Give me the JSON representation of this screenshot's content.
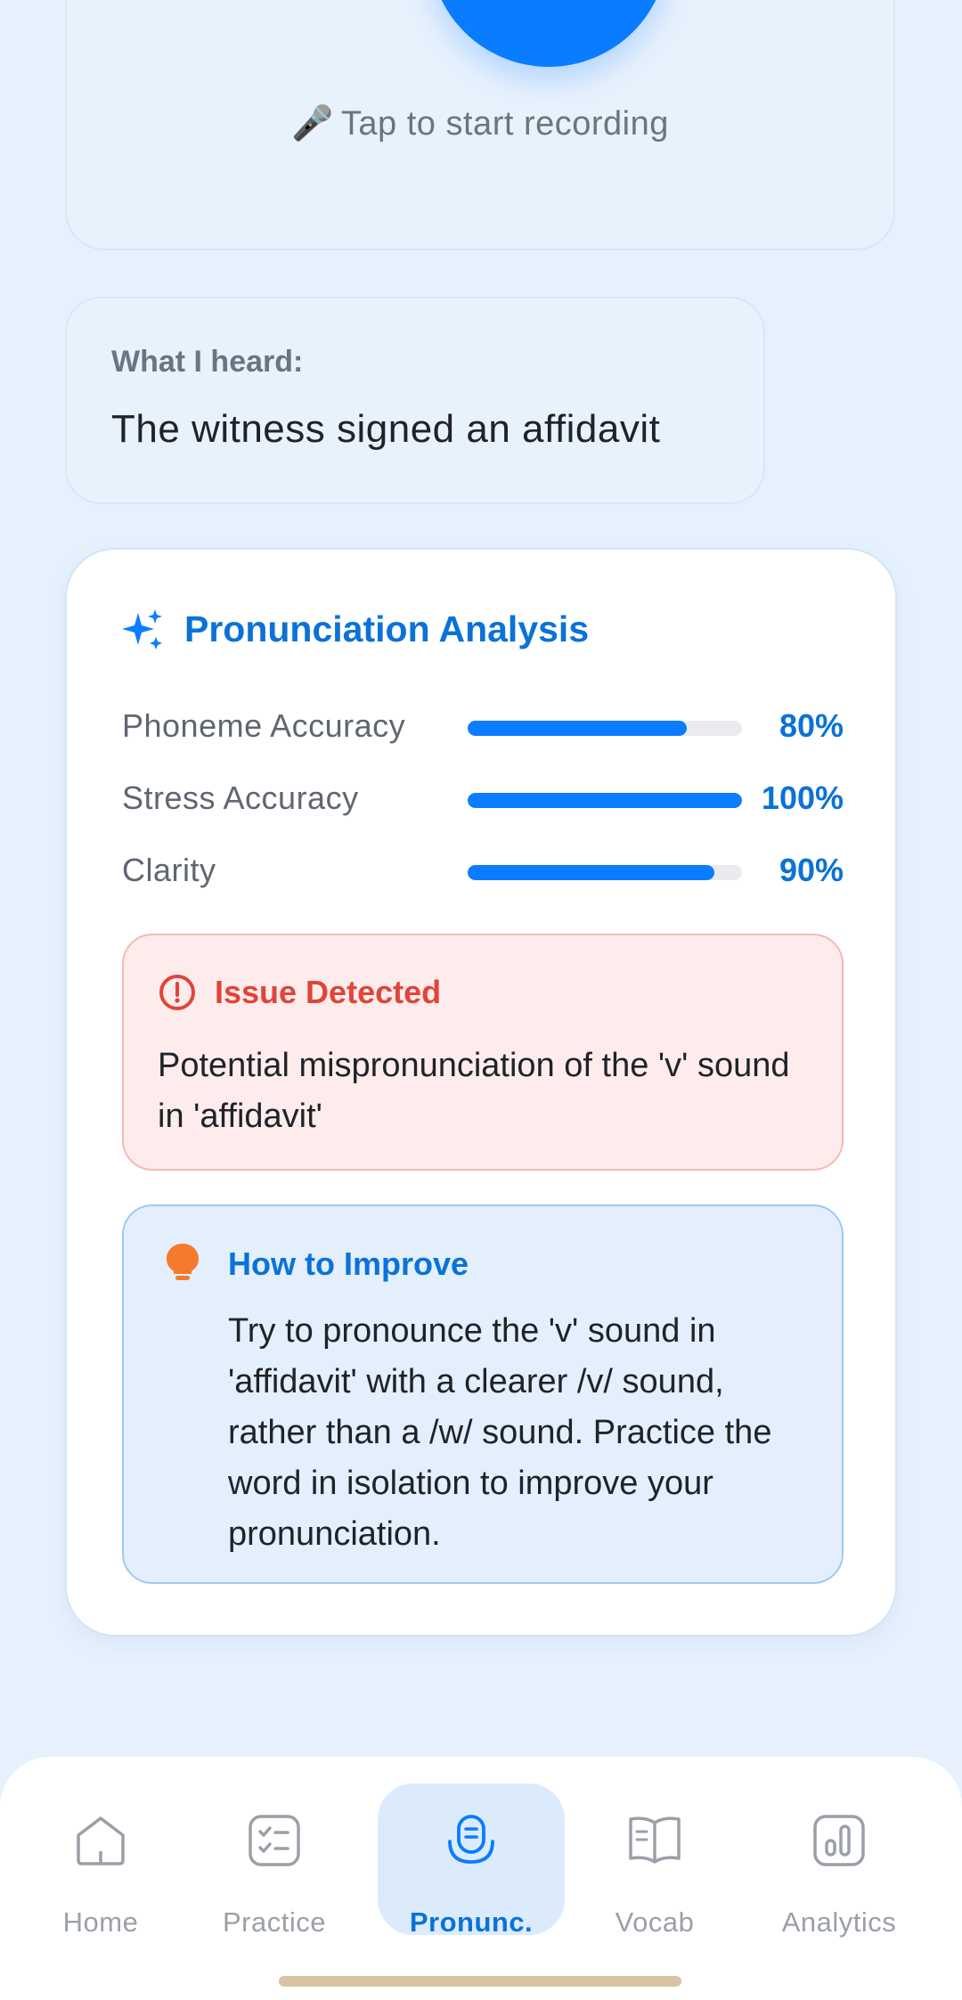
{
  "recording": {
    "emoji": "🎤",
    "hint": "Tap to start recording"
  },
  "heard": {
    "label": "What I heard:",
    "text": "The witness signed an affidavit"
  },
  "analysis": {
    "title": "Pronunciation Analysis",
    "metrics": [
      {
        "label": "Phoneme Accuracy",
        "value": 80,
        "display": "80%"
      },
      {
        "label": "Stress Accuracy",
        "value": 100,
        "display": "100%"
      },
      {
        "label": "Clarity",
        "value": 90,
        "display": "90%"
      }
    ],
    "issue": {
      "title": "Issue Detected",
      "text": "Potential mispronunciation of the 'v' sound in 'affidavit'"
    },
    "improve": {
      "title": "How to Improve",
      "text": "Try to pronounce the 'v' sound in 'affidavit' with a clearer /v/ sound, rather than a /w/ sound. Practice the word in isolation to improve your pronunciation."
    }
  },
  "nav": {
    "items": [
      {
        "label": "Home",
        "icon": "home-icon"
      },
      {
        "label": "Practice",
        "icon": "checklist-icon"
      },
      {
        "label": "Pronunc.",
        "icon": "microphone-icon"
      },
      {
        "label": "Vocab",
        "icon": "book-icon"
      },
      {
        "label": "Analytics",
        "icon": "chart-icon"
      }
    ],
    "active": "Pronunc."
  },
  "colors": {
    "primary": "#0a7cff",
    "issue": "#e0443a",
    "tip": "#f47a2c"
  }
}
